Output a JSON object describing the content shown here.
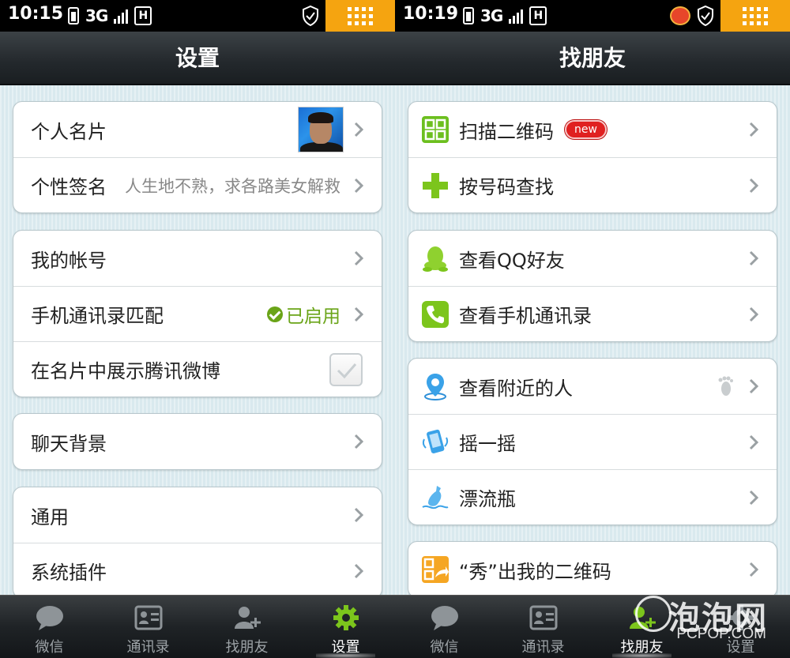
{
  "left": {
    "status": {
      "time": "10:15",
      "network": "3G",
      "data_type": "H"
    },
    "title": "设置",
    "groups": [
      {
        "rows": [
          {
            "label": "个人名片"
          },
          {
            "label": "个性签名",
            "value": "人生地不熟，求各路美女解救"
          }
        ]
      },
      {
        "rows": [
          {
            "label": "我的帐号"
          },
          {
            "label": "手机通讯录匹配",
            "status": "已启用"
          },
          {
            "label": "在名片中展示腾讯微博",
            "checked": true
          }
        ]
      },
      {
        "rows": [
          {
            "label": "聊天背景"
          }
        ]
      },
      {
        "rows": [
          {
            "label": "通用"
          },
          {
            "label": "系统插件"
          }
        ]
      }
    ],
    "tabs": [
      {
        "label": "微信"
      },
      {
        "label": "通讯录"
      },
      {
        "label": "找朋友"
      },
      {
        "label": "设置",
        "active": true
      }
    ]
  },
  "right": {
    "status": {
      "time": "10:19",
      "network": "3G",
      "data_type": "H"
    },
    "title": "找朋友",
    "groups": [
      {
        "rows": [
          {
            "label": "扫描二维码",
            "badge": "new",
            "icon": "qr-code-icon"
          },
          {
            "label": "按号码查找",
            "icon": "plus-icon"
          }
        ]
      },
      {
        "rows": [
          {
            "label": "查看QQ好友",
            "icon": "qq-penguin-icon"
          },
          {
            "label": "查看手机通讯录",
            "icon": "phone-icon"
          }
        ]
      },
      {
        "rows": [
          {
            "label": "查看附近的人",
            "icon": "location-pin-icon"
          },
          {
            "label": "摇一摇",
            "icon": "shake-phone-icon"
          },
          {
            "label": "漂流瓶",
            "icon": "bottle-icon"
          }
        ]
      },
      {
        "rows": [
          {
            "label": "“秀”出我的二维码",
            "icon": "share-qr-icon"
          }
        ]
      }
    ],
    "tabs": [
      {
        "label": "微信"
      },
      {
        "label": "通讯录"
      },
      {
        "label": "找朋友",
        "active": true
      },
      {
        "label": "设置"
      }
    ]
  },
  "watermark": {
    "brand": "泡泡网",
    "url": "PCPOP.COM"
  },
  "colors": {
    "accent_green": "#6aa418",
    "menu_orange": "#f5a410",
    "badge_red": "#e02020",
    "titlebar": "#2a2f33"
  }
}
